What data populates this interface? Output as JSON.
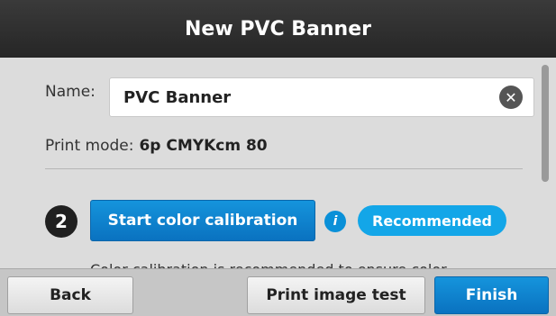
{
  "title": "New PVC Banner",
  "form": {
    "name_label": "Name:",
    "name_value": "PVC Banner",
    "print_mode_label": "Print mode:",
    "print_mode_value": "6p CMYKcm 80"
  },
  "step": {
    "number": "2",
    "button_label": "Start color calibration",
    "info_icon": "i",
    "badge": "Recommended",
    "note": "Color calibration is recommended to ensure color"
  },
  "footer": {
    "back": "Back",
    "print_test": "Print image test",
    "finish": "Finish"
  },
  "colors": {
    "accent": "#0a7fcf",
    "badge": "#13a6e8",
    "titlebar": "#2e2e2e"
  }
}
